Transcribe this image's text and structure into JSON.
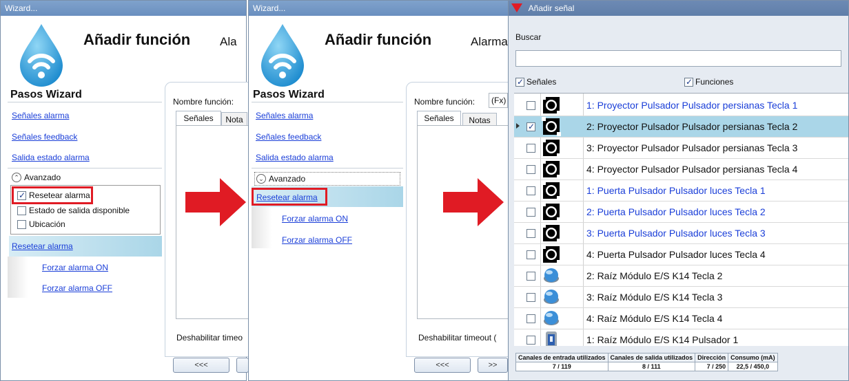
{
  "window1": {
    "title": "Wizard...",
    "header": "Añadir función",
    "subheader": "Ala",
    "steps_title": "Pasos Wizard",
    "steps": [
      "Señales alarma",
      "Señales feedback",
      "Salida estado alarma"
    ],
    "advanced_label": "Avanzado",
    "options": [
      {
        "label": "Resetear alarma",
        "checked": true
      },
      {
        "label": "Estado de salida disponible",
        "checked": false
      },
      {
        "label": "Ubicación",
        "checked": false
      }
    ],
    "extra_steps": [
      "Resetear alarma",
      "Forzar alarma ON",
      "Forzar alarma OFF"
    ],
    "name_label": "Nombre función:",
    "tabs": [
      "Señales",
      "Nota"
    ],
    "timeout_label": "Deshabilitar timeo",
    "back_button": "<<<"
  },
  "window2": {
    "title": "Wizard...",
    "header": "Añadir función",
    "subheader": "Alarma",
    "steps_title": "Pasos Wizard",
    "steps": [
      "Señales alarma",
      "Señales feedback",
      "Salida estado alarma"
    ],
    "advanced_label": "Avanzado",
    "extra_steps": [
      "Resetear alarma",
      "Forzar alarma ON",
      "Forzar alarma OFF"
    ],
    "name_label": "Nombre función:",
    "name_value": "(Fx)",
    "tabs": [
      "Señales",
      "Notas"
    ],
    "timeout_label": "Deshabilitar timeout (",
    "back_button": "<<<",
    "next_button": ">>"
  },
  "window3": {
    "title": "Añadir señal",
    "search_label": "Buscar",
    "search_value": "",
    "filter_signals": {
      "label": "Señales",
      "checked": true
    },
    "filter_functions": {
      "label": "Funciones",
      "checked": true
    },
    "signals": [
      {
        "label": "1: Proyector Pulsador Pulsador persianas Tecla 1",
        "checked": false,
        "blue": true,
        "icon": "pushbutton-icon"
      },
      {
        "label": "2: Proyector Pulsador Pulsador persianas Tecla 2",
        "checked": true,
        "blue": false,
        "icon": "pushbutton-icon"
      },
      {
        "label": "3: Proyector Pulsador Pulsador persianas Tecla 3",
        "checked": false,
        "blue": false,
        "icon": "pushbutton-icon"
      },
      {
        "label": "4: Proyector Pulsador Pulsador persianas Tecla 4",
        "checked": false,
        "blue": false,
        "icon": "pushbutton-icon"
      },
      {
        "label": "1: Puerta Pulsador Pulsador luces Tecla 1",
        "checked": false,
        "blue": true,
        "icon": "pushbutton-icon"
      },
      {
        "label": "2: Puerta Pulsador Pulsador luces Tecla 2",
        "checked": false,
        "blue": true,
        "icon": "pushbutton-icon"
      },
      {
        "label": "3: Puerta Pulsador Pulsador luces Tecla 3",
        "checked": false,
        "blue": true,
        "icon": "pushbutton-icon"
      },
      {
        "label": "4: Puerta Pulsador Pulsador luces Tecla 4",
        "checked": false,
        "blue": false,
        "icon": "pushbutton-icon"
      },
      {
        "label": "2: Raíz Módulo E/S K14 Tecla 2",
        "checked": false,
        "blue": false,
        "icon": "blue-button-icon"
      },
      {
        "label": "3: Raíz Módulo E/S K14 Tecla 3",
        "checked": false,
        "blue": false,
        "icon": "blue-button-icon"
      },
      {
        "label": "4: Raíz Módulo E/S K14 Tecla 4",
        "checked": false,
        "blue": false,
        "icon": "blue-button-icon"
      },
      {
        "label": "1: Raíz Módulo E/S K14 Pulsador 1",
        "checked": false,
        "blue": false,
        "icon": "module-icon"
      }
    ],
    "status": {
      "headers": [
        "Canales de entrada utilizados",
        "Canales de salida utilizados",
        "Dirección",
        "Consumo (mA)"
      ],
      "values": [
        "7 / 119",
        "8 / 111",
        "7 / 250",
        "22,5 / 450,0"
      ]
    }
  },
  "colors": {
    "accent": "#e01b24",
    "link": "#1a3ed8",
    "titlebar": "#6a8fbf",
    "highlight": "#aad6e8"
  }
}
